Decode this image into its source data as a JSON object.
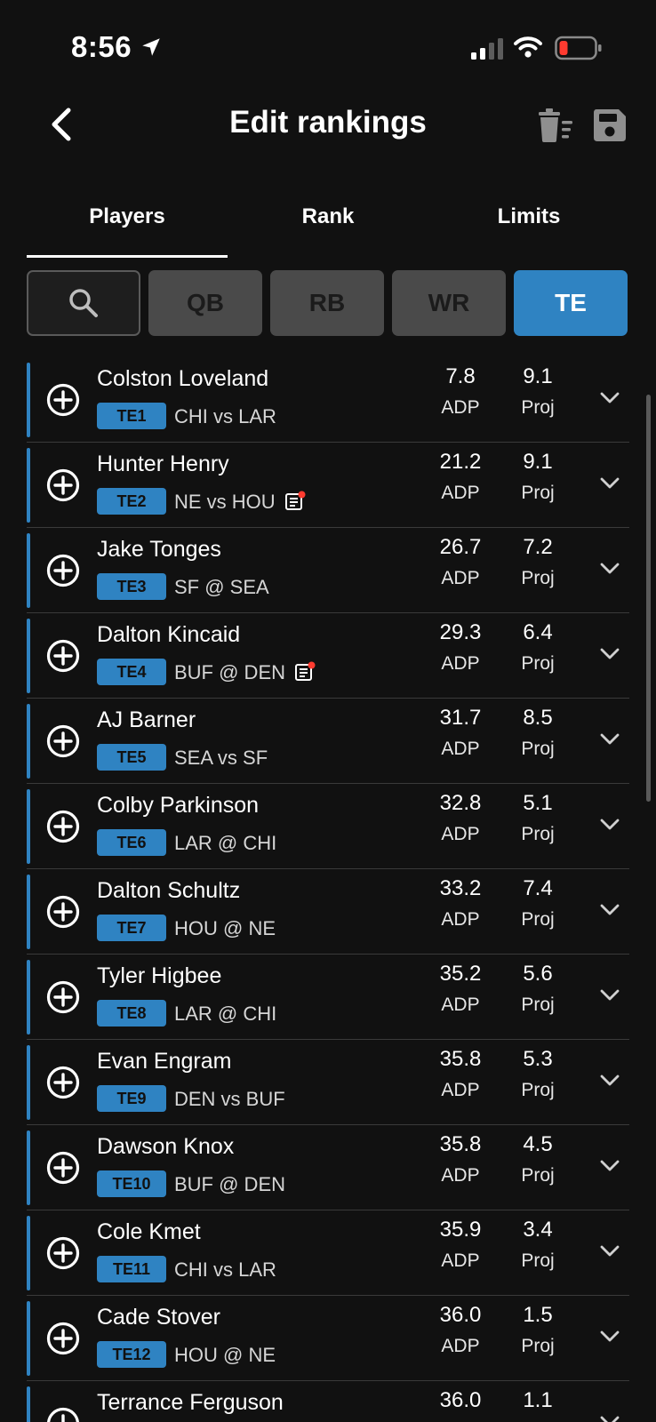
{
  "status": {
    "time": "8:56",
    "icons": [
      "location-arrow-icon",
      "cellular-signal-icon",
      "wifi-icon",
      "battery-low-icon"
    ],
    "battery_color": "#ff3b30"
  },
  "header": {
    "title": "Edit rankings",
    "icons": [
      "back-chevron-icon",
      "clear-list-icon",
      "save-floppy-icon"
    ]
  },
  "tabs": [
    {
      "label": "Players",
      "active": true
    },
    {
      "label": "Rank",
      "active": false
    },
    {
      "label": "Limits",
      "active": false
    }
  ],
  "filters": {
    "search_icon": "search-icon",
    "positions": [
      {
        "label": "QB",
        "active": false
      },
      {
        "label": "RB",
        "active": false
      },
      {
        "label": "WR",
        "active": false
      },
      {
        "label": "TE",
        "active": true
      }
    ]
  },
  "colors": {
    "accent": "#2f83c2",
    "background": "#111111",
    "inactive_filter": "#4a4a4a",
    "news_dot": "#ff3b30"
  },
  "columns": {
    "adp_label": "ADP",
    "proj_label": "Proj"
  },
  "players": [
    {
      "name": "Colston Loveland",
      "rank": "TE1",
      "matchup": "CHI vs LAR",
      "adp": "7.8",
      "proj": "9.1",
      "news": false
    },
    {
      "name": "Hunter Henry",
      "rank": "TE2",
      "matchup": "NE vs HOU",
      "adp": "21.2",
      "proj": "9.1",
      "news": true
    },
    {
      "name": "Jake Tonges",
      "rank": "TE3",
      "matchup": "SF @ SEA",
      "adp": "26.7",
      "proj": "7.2",
      "news": false
    },
    {
      "name": "Dalton Kincaid",
      "rank": "TE4",
      "matchup": "BUF @ DEN",
      "adp": "29.3",
      "proj": "6.4",
      "news": true
    },
    {
      "name": "AJ Barner",
      "rank": "TE5",
      "matchup": "SEA vs SF",
      "adp": "31.7",
      "proj": "8.5",
      "news": false
    },
    {
      "name": "Colby Parkinson",
      "rank": "TE6",
      "matchup": "LAR @ CHI",
      "adp": "32.8",
      "proj": "5.1",
      "news": false
    },
    {
      "name": "Dalton Schultz",
      "rank": "TE7",
      "matchup": "HOU @ NE",
      "adp": "33.2",
      "proj": "7.4",
      "news": false
    },
    {
      "name": "Tyler Higbee",
      "rank": "TE8",
      "matchup": "LAR @ CHI",
      "adp": "35.2",
      "proj": "5.6",
      "news": false
    },
    {
      "name": "Evan Engram",
      "rank": "TE9",
      "matchup": "DEN vs BUF",
      "adp": "35.8",
      "proj": "5.3",
      "news": false
    },
    {
      "name": "Dawson Knox",
      "rank": "TE10",
      "matchup": "BUF @ DEN",
      "adp": "35.8",
      "proj": "4.5",
      "news": false
    },
    {
      "name": "Cole Kmet",
      "rank": "TE11",
      "matchup": "CHI vs LAR",
      "adp": "35.9",
      "proj": "3.4",
      "news": false
    },
    {
      "name": "Cade Stover",
      "rank": "TE12",
      "matchup": "HOU @ NE",
      "adp": "36.0",
      "proj": "1.5",
      "news": false
    },
    {
      "name": "Terrance Ferguson",
      "rank": "",
      "matchup": "",
      "adp": "36.0",
      "proj": "1.1",
      "news": false
    }
  ]
}
